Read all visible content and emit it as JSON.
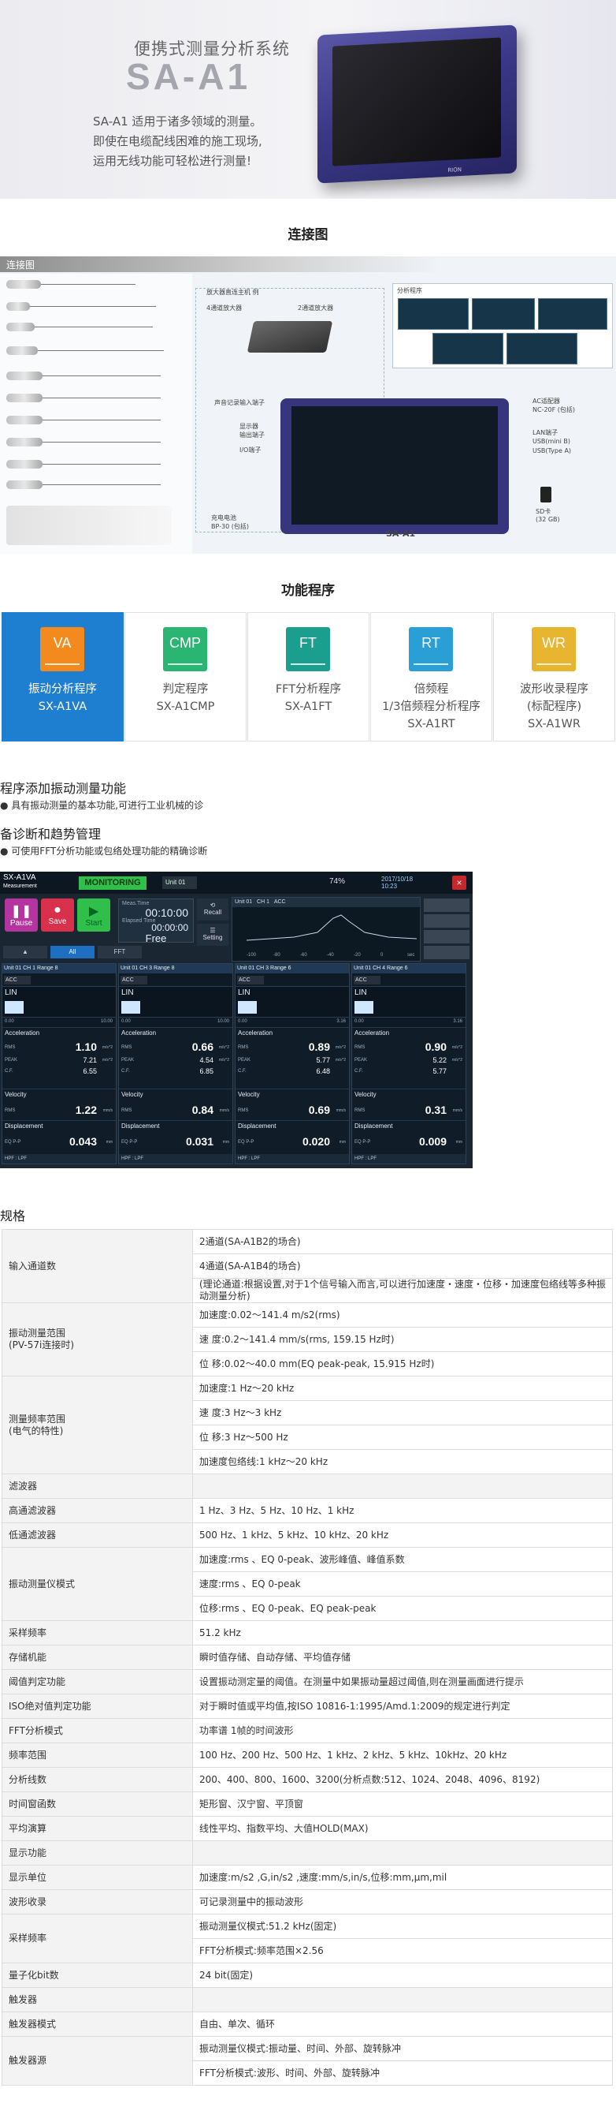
{
  "hero": {
    "tagline": "便携式测量分析系统",
    "model": "SA-A1",
    "desc": [
      "SA-A1 适用于诸多领域的测量。",
      "即使在电缆配线困难的施工现场,",
      "运用无线功能可轻松进行测量!"
    ],
    "device_logo": "RION"
  },
  "connection": {
    "section_title": "连接图",
    "header": "连接图",
    "labels": {
      "amp_box": "放大器直连主机 例",
      "amp4": "4通道放大器",
      "amp2": "2通道放大器",
      "prog": "分析程序",
      "mic": "声音记录输入端子",
      "disp": "显示器\n输出端子",
      "io": "I/O端子",
      "batt": "充电电池\nBP-30 (包括)",
      "ac": "AC适配器\nNC-20F (包括)",
      "lan": "LAN端子",
      "usbmini": "USB(mini B)",
      "usbc": "USB(Type A)",
      "sd": "SD卡\n(32 GB)",
      "device": "SA-A1"
    }
  },
  "programs": {
    "section_title": "功能程序",
    "items": [
      {
        "code": "VA",
        "name": [
          "振动分析程序",
          "SX-A1VA"
        ],
        "color": "#f28a1e",
        "active": true
      },
      {
        "code": "CMP",
        "name": [
          "判定程序",
          "SX-A1CMP"
        ],
        "color": "#2bb573",
        "active": false
      },
      {
        "code": "FT",
        "name": [
          "FFT分析程序",
          "SX-A1FT"
        ],
        "color": "#1a9e8e",
        "active": false
      },
      {
        "code": "RT",
        "name": [
          "倍频程",
          "1/3倍频程分析程序",
          "SX-A1RT"
        ],
        "color": "#2a9fd6",
        "active": false
      },
      {
        "code": "WR",
        "name": [
          "波形收录程序",
          "(标配程序)",
          "SX-A1WR"
        ],
        "color": "#e8b531",
        "active": false
      }
    ]
  },
  "features": [
    {
      "title": "程序添加振动测量功能",
      "note": "● 具有振动测量的基本功能,可进行工业机械的诊"
    },
    {
      "title": "备诊断和趋势管理",
      "note": "● 可使用FFT分析功能或包络处理功能的精确诊断"
    }
  ],
  "app": {
    "logo": [
      "SX-A1VA",
      "Measurement"
    ],
    "mode": "MONITORING",
    "unit_select": "Unit 01",
    "battery": "74%",
    "date": [
      "2017/10/18",
      "10:23"
    ],
    "close": "×",
    "controls": {
      "pause": "Pause",
      "save": "Save",
      "start": "Start"
    },
    "timer": {
      "meas_time_label": "Meas.Time",
      "meas_time": "00:10:00",
      "elapsed_label": "Elapsed Time",
      "elapsed": "00:00:00",
      "mode": "Free"
    },
    "side_buttons": [
      "Recall",
      "Setting"
    ],
    "tabs": [
      "",
      "All",
      "FFT"
    ],
    "fft": {
      "unit": "Unit 01",
      "ch": "CH 1",
      "type": "ACC",
      "x_ticks": [
        "-100",
        "-80",
        "-60",
        "-40",
        "-20",
        "0",
        "sec"
      ]
    },
    "channels": [
      {
        "head": "Unit 01  CH 1  Range 8",
        "type": "ACC",
        "mode": "LIN",
        "scale_l": "0.00",
        "scale_r": "10.00",
        "acc_rms": "1.10",
        "acc_peak": "7.21",
        "acc_cf": "6.55",
        "vel_rms": "1.22",
        "disp_eqpp": "0.043"
      },
      {
        "head": "Unit 01  CH 3  Range 8",
        "type": "ACC",
        "mode": "LIN",
        "scale_l": "0.00",
        "scale_r": "10.00",
        "acc_rms": "0.66",
        "acc_peak": "4.54",
        "acc_cf": "6.85",
        "vel_rms": "0.84",
        "disp_eqpp": "0.031"
      },
      {
        "head": "Unit 01  CH 3  Range 6",
        "type": "ACC",
        "mode": "LIN",
        "scale_l": "0.00",
        "scale_r": "3.16",
        "acc_rms": "0.89",
        "acc_peak": "5.77",
        "acc_cf": "6.48",
        "vel_rms": "0.69",
        "disp_eqpp": "0.020"
      },
      {
        "head": "Unit 01  CH 4  Range 6",
        "type": "ACC",
        "mode": "LIN",
        "scale_l": "0.00",
        "scale_r": "3.16",
        "acc_rms": "0.90",
        "acc_peak": "5.22",
        "acc_cf": "5.77",
        "vel_rms": "0.31",
        "disp_eqpp": "0.009"
      }
    ],
    "labels": {
      "acceleration": "Acceleration",
      "rms": "RMS",
      "peak": "PEAK",
      "cf": "C.F.",
      "velocity": "Velocity",
      "displacement": "Displacement",
      "eqpp": "EQ P-P",
      "acc_unit": "m/s^2",
      "vel_unit": "mm/s",
      "disp_unit": "mm",
      "foot": "HPF : LPF"
    }
  },
  "spec": {
    "title": "规格",
    "rows": [
      {
        "key": "输入通道数",
        "values": [
          "2通道(SA-A1B2的场合)",
          "4通道(SA-A1B4的场合)",
          "(理论通道:根据设置,对于1个信号输入而言,可以进行加速度・速度・位移・加速度包络线等多种振动测量分析)"
        ]
      },
      {
        "key": "振动测量范围\n(PV-57i连接时)",
        "values": [
          "加速度:0.02〜141.4 m/s2(rms)",
          "速 度:0.2〜141.4 mm/s(rms, 159.15 Hz时)",
          "位 移:0.02〜40.0 mm(EQ peak-peak, 15.915 Hz时)"
        ]
      },
      {
        "key": "测量频率范围\n(电气的特性)",
        "values": [
          "加速度:1 Hz〜20 kHz",
          "速 度:3 Hz〜3 kHz",
          "位 移:3 Hz〜500 Hz",
          "加速度包络线:1 kHz〜20 kHz"
        ]
      },
      {
        "key": "滤波器",
        "values": [
          ""
        ],
        "header": true
      },
      {
        "key": "高通滤波器",
        "values": [
          "1 Hz、3 Hz、5 Hz、10 Hz、1 kHz"
        ]
      },
      {
        "key": "低通滤波器",
        "values": [
          "500 Hz、1 kHz、5 kHz、10 kHz、20 kHz"
        ]
      },
      {
        "key": "振动测量仪模式",
        "values": [
          "加速度:rms 、EQ 0-peak、波形峰值、峰值系数",
          "速度:rms 、EQ 0-peak",
          "位移:rms 、EQ 0-peak、EQ peak-peak"
        ]
      },
      {
        "key": "采样频率",
        "values": [
          "51.2 kHz"
        ]
      },
      {
        "key": "存储机能",
        "values": [
          "瞬时值存储、自动存储、平均值存储"
        ]
      },
      {
        "key": "阈值判定功能",
        "values": [
          "设置振动测定量的阈值。在测量中如果振动量超过阈值,则在测量画面进行提示"
        ]
      },
      {
        "key": "ISO绝对值判定功能",
        "values": [
          "对于瞬时值或平均值,按ISO 10816-1:1995/Amd.1:2009的规定进行判定"
        ]
      },
      {
        "key": "FFT分析模式",
        "values": [
          "功率谱 1帧的时间波形"
        ]
      },
      {
        "key": "频率范围",
        "values": [
          "100 Hz、200 Hz、500 Hz、1 kHz、2 kHz、5 kHz、10kHz、20 kHz"
        ]
      },
      {
        "key": "分析线数",
        "values": [
          "200、400、800、1600、3200(分析点数:512、1024、2048、4096、8192)"
        ]
      },
      {
        "key": "时间窗函数",
        "values": [
          "矩形窗、汉宁窗、平顶窗"
        ]
      },
      {
        "key": "平均演算",
        "values": [
          "线性平均、指数平均、大值HOLD(MAX)"
        ]
      },
      {
        "key": "显示功能",
        "values": [
          ""
        ],
        "header": true
      },
      {
        "key": "显示单位",
        "values": [
          "加速度:m/s2 ,G,in/s2 ,速度:mm/s,in/s,位移:mm,μm,mil"
        ]
      },
      {
        "key": "波形收录",
        "values": [
          "可记录测量中的振动波形"
        ]
      },
      {
        "key": "采样频率",
        "values": [
          "振动测量仪模式:51.2 kHz(固定)",
          "FFT分析模式:频率范围×2.56"
        ]
      },
      {
        "key": "量子化bit数",
        "values": [
          "24 bit(固定)"
        ]
      },
      {
        "key": "触发器",
        "values": [
          ""
        ],
        "header": true
      },
      {
        "key": "触发器模式",
        "values": [
          "自由、单次、循环"
        ]
      },
      {
        "key": "触发器源",
        "values": [
          "振动测量仪模式:振动量、时间、外部、旋转脉冲",
          "FFT分析模式:波形、时间、外部、旋转脉冲"
        ]
      }
    ]
  }
}
